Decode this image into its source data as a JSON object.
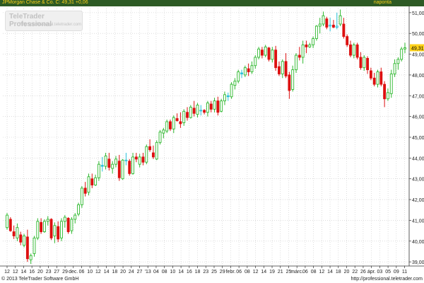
{
  "header": {
    "title": "JPMorgan Chase & Co. C: 49,31 +0,06",
    "period": "napontа"
  },
  "watermark": {
    "brand": "TeleTrader Professional",
    "url": "http://professional.teletrader.com"
  },
  "footer": {
    "copyright": "© 2013 TeleTrader Software GmbH",
    "url": "http://professional.teletrader.com"
  },
  "colors": {
    "up": "#2eb82e",
    "down": "#dd1010",
    "neutral": "#26c0d8",
    "last_price_badge": "#ffd21a",
    "header_bg": "#2d5a24"
  },
  "chart_data": {
    "type": "candlestick",
    "title": "",
    "xlabel": "",
    "ylabel": "",
    "ylim": [
      38.8,
      51.2
    ],
    "yticks": [
      "39,00",
      "40,00",
      "41,00",
      "42,00",
      "43,00",
      "44,00",
      "45,00",
      "46,00",
      "47,00",
      "48,00",
      "49,00",
      "50,00",
      "51,00"
    ],
    "last_price": "49,31",
    "xticks": [
      "12",
      "12",
      "14",
      "16",
      "20",
      "23",
      "27",
      "29",
      "dec.",
      "06",
      "10",
      "12",
      "14",
      "18",
      "20",
      "24",
      "27",
      "'13",
      "04",
      "08",
      "10",
      "14",
      "16",
      "18",
      "23",
      "25",
      "29",
      "febr.",
      "06",
      "08",
      "12",
      "14",
      "19",
      "21",
      "25",
      "márc.",
      "06",
      "08",
      "12",
      "14",
      "18",
      "20",
      "22",
      "26",
      "ápr.",
      "03",
      "05",
      "09",
      "11"
    ],
    "grid": true,
    "series": [
      {
        "ohlc": [
          [
            40.65,
            41.35,
            40.55,
            41.25
          ],
          [
            41.05,
            41.15,
            40.45,
            40.5
          ],
          [
            40.45,
            40.75,
            40.1,
            40.25
          ],
          [
            40.15,
            40.85,
            40.0,
            40.65
          ],
          [
            40.3,
            40.45,
            39.8,
            39.95
          ],
          [
            39.8,
            40.35,
            39.7,
            40.25
          ],
          [
            40.2,
            40.55,
            39.0,
            39.15
          ],
          [
            39.1,
            39.4,
            38.9,
            39.3
          ],
          [
            39.4,
            40.25,
            39.25,
            40.15
          ],
          [
            40.15,
            41.1,
            40.05,
            40.95
          ],
          [
            40.9,
            41.1,
            40.35,
            40.45
          ],
          [
            40.45,
            41.05,
            40.4,
            40.95
          ],
          [
            40.95,
            41.2,
            40.75,
            41.05
          ],
          [
            41.05,
            41.1,
            40.05,
            40.15
          ],
          [
            40.25,
            40.9,
            39.9,
            40.75
          ],
          [
            40.7,
            40.95,
            39.95,
            40.1
          ],
          [
            40.15,
            41.1,
            40.0,
            40.95
          ],
          [
            40.95,
            41.25,
            40.65,
            41.15
          ],
          [
            41.1,
            41.15,
            40.35,
            40.45
          ],
          [
            40.5,
            41.15,
            40.35,
            41.05
          ],
          [
            41.05,
            41.35,
            40.85,
            41.25
          ],
          [
            41.3,
            41.85,
            41.2,
            41.75
          ],
          [
            41.75,
            42.65,
            41.6,
            42.55
          ],
          [
            42.55,
            42.85,
            42.15,
            42.3
          ],
          [
            42.35,
            43.25,
            42.2,
            43.1
          ],
          [
            43.0,
            43.25,
            42.55,
            42.7
          ],
          [
            42.7,
            43.2,
            42.65,
            43.05
          ],
          [
            43.05,
            43.85,
            42.9,
            43.7
          ],
          [
            43.65,
            44.05,
            43.35,
            43.6
          ],
          [
            43.6,
            44.25,
            43.45,
            44.1
          ],
          [
            43.95,
            44.25,
            43.4,
            43.55
          ],
          [
            43.5,
            43.85,
            43.25,
            43.7
          ],
          [
            43.7,
            44.1,
            43.55,
            43.95
          ],
          [
            43.85,
            44.15,
            42.9,
            43.05
          ],
          [
            43.0,
            43.95,
            42.95,
            43.9
          ],
          [
            43.9,
            44.25,
            43.65,
            43.9
          ],
          [
            43.85,
            43.95,
            43.15,
            43.25
          ],
          [
            43.25,
            44.25,
            43.2,
            44.05
          ],
          [
            44.05,
            44.25,
            43.8,
            43.95
          ],
          [
            43.7,
            44.2,
            43.55,
            44.05
          ],
          [
            44.05,
            44.25,
            43.65,
            43.8
          ],
          [
            43.8,
            44.65,
            43.7,
            44.55
          ],
          [
            44.55,
            44.9,
            44.3,
            44.4
          ],
          [
            44.25,
            44.6,
            43.95,
            44.05
          ],
          [
            43.95,
            44.85,
            43.9,
            44.75
          ],
          [
            44.75,
            45.35,
            44.65,
            45.25
          ],
          [
            45.2,
            45.45,
            44.95,
            45.35
          ],
          [
            45.3,
            45.85,
            45.2,
            45.75
          ],
          [
            45.75,
            45.85,
            45.3,
            45.4
          ],
          [
            45.4,
            46.05,
            45.2,
            45.95
          ],
          [
            45.9,
            46.15,
            45.75,
            45.8
          ],
          [
            45.75,
            46.2,
            45.45,
            45.65
          ],
          [
            45.7,
            46.35,
            45.55,
            46.25
          ],
          [
            46.2,
            46.45,
            45.8,
            45.95
          ],
          [
            45.95,
            46.55,
            45.9,
            46.45
          ],
          [
            46.4,
            46.75,
            46.0,
            46.15
          ],
          [
            46.1,
            46.65,
            45.95,
            46.55
          ],
          [
            46.3,
            46.55,
            46.05,
            46.3
          ],
          [
            46.3,
            46.35,
            46.1,
            46.2
          ],
          [
            46.2,
            46.75,
            46.0,
            46.65
          ],
          [
            46.6,
            46.75,
            46.2,
            46.35
          ],
          [
            46.35,
            46.9,
            46.2,
            46.75
          ],
          [
            46.75,
            46.95,
            46.05,
            46.2
          ],
          [
            46.25,
            46.85,
            46.2,
            46.75
          ],
          [
            46.75,
            47.2,
            46.55,
            47.05
          ],
          [
            47.0,
            47.15,
            46.75,
            46.95
          ],
          [
            46.95,
            47.65,
            46.85,
            47.55
          ],
          [
            47.5,
            47.85,
            47.3,
            47.7
          ],
          [
            47.7,
            48.25,
            47.6,
            48.15
          ],
          [
            48.1,
            48.25,
            47.85,
            48.05
          ],
          [
            48.0,
            48.45,
            47.9,
            48.35
          ],
          [
            48.3,
            48.55,
            47.95,
            48.15
          ],
          [
            48.15,
            48.65,
            48.05,
            48.45
          ],
          [
            48.45,
            48.95,
            48.3,
            48.85
          ],
          [
            48.85,
            49.35,
            48.75,
            49.25
          ],
          [
            49.2,
            49.35,
            48.8,
            48.95
          ],
          [
            48.95,
            49.45,
            48.85,
            49.35
          ],
          [
            49.3,
            49.35,
            48.65,
            48.75
          ],
          [
            48.75,
            49.35,
            48.6,
            49.2
          ],
          [
            49.2,
            49.4,
            48.2,
            48.35
          ],
          [
            48.4,
            48.65,
            47.95,
            48.05
          ],
          [
            48.05,
            48.75,
            47.85,
            48.65
          ],
          [
            48.65,
            49.05,
            47.85,
            47.95
          ],
          [
            48.0,
            48.15,
            46.85,
            47.25
          ],
          [
            47.3,
            48.45,
            47.2,
            48.25
          ],
          [
            48.25,
            49.05,
            48.1,
            48.95
          ],
          [
            48.95,
            49.35,
            48.7,
            48.85
          ],
          [
            48.85,
            49.65,
            48.55,
            49.45
          ],
          [
            49.45,
            49.65,
            49.05,
            49.35
          ],
          [
            49.35,
            49.55,
            49.3,
            49.45
          ],
          [
            49.45,
            49.85,
            49.3,
            49.75
          ],
          [
            49.75,
            50.4,
            49.65,
            50.35
          ],
          [
            50.35,
            50.75,
            50.0,
            50.45
          ],
          [
            50.45,
            51.05,
            50.35,
            50.85
          ],
          [
            50.7,
            50.8,
            50.2,
            50.3
          ],
          [
            50.35,
            50.75,
            50.1,
            50.4
          ],
          [
            50.4,
            50.65,
            50.25,
            50.3
          ],
          [
            50.3,
            51.0,
            50.2,
            50.35
          ],
          [
            50.45,
            51.15,
            50.35,
            50.85
          ],
          [
            50.45,
            50.75,
            49.75,
            49.85
          ],
          [
            49.85,
            49.95,
            49.35,
            49.45
          ],
          [
            49.45,
            49.65,
            48.85,
            48.95
          ],
          [
            48.95,
            49.55,
            48.8,
            49.45
          ],
          [
            49.45,
            49.55,
            48.75,
            48.85
          ],
          [
            48.85,
            49.1,
            48.25,
            48.35
          ],
          [
            48.35,
            48.95,
            48.2,
            48.85
          ],
          [
            48.8,
            48.9,
            48.05,
            48.25
          ],
          [
            48.2,
            48.35,
            47.75,
            47.85
          ],
          [
            47.85,
            48.1,
            47.45,
            47.55
          ],
          [
            47.55,
            48.25,
            47.4,
            48.15
          ],
          [
            48.15,
            48.35,
            47.45,
            47.55
          ],
          [
            47.55,
            47.7,
            46.45,
            46.85
          ],
          [
            46.85,
            47.35,
            46.75,
            47.15
          ],
          [
            47.1,
            48.25,
            46.9,
            48.05
          ],
          [
            48.05,
            48.75,
            47.9,
            48.55
          ],
          [
            48.55,
            48.85,
            48.25,
            48.75
          ],
          [
            48.75,
            49.35,
            48.65,
            49.25
          ],
          [
            49.25,
            49.55,
            49.05,
            49.31
          ]
        ]
      }
    ]
  }
}
